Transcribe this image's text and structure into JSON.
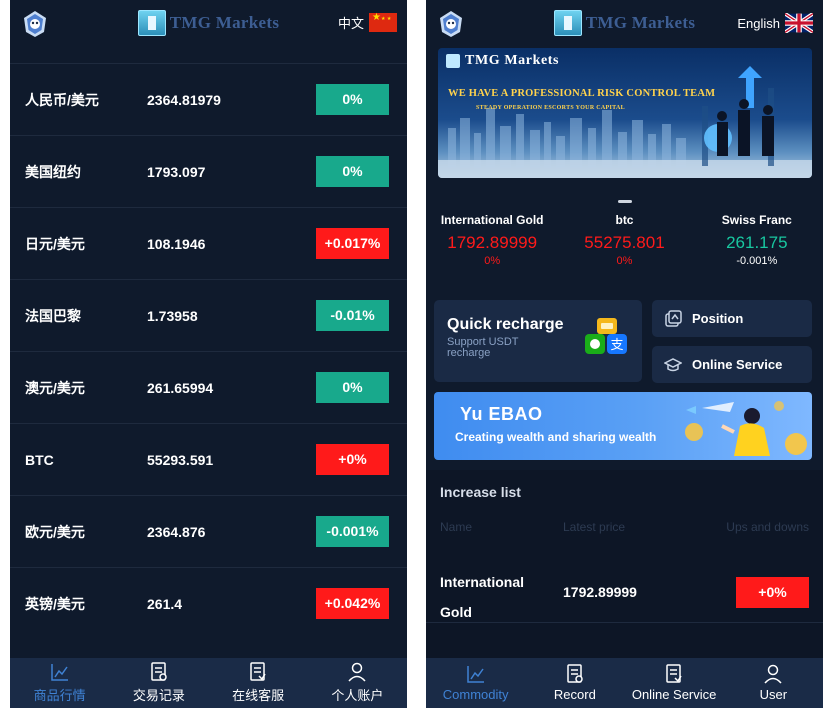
{
  "left": {
    "brand": "TMG Markets",
    "language": "中文",
    "markets": [
      {
        "name": "人民币/美元",
        "price": "2364.81979",
        "change": "0%",
        "trend": "flat"
      },
      {
        "name": "美国纽约",
        "price": "1793.097",
        "change": "0%",
        "trend": "flat"
      },
      {
        "name": "日元/美元",
        "price": "108.1946",
        "change": "+0.017%",
        "trend": "up"
      },
      {
        "name": "法国巴黎",
        "price": "1.73958",
        "change": "-0.01%",
        "trend": "down"
      },
      {
        "name": "澳元/美元",
        "price": "261.65994",
        "change": "0%",
        "trend": "flat"
      },
      {
        "name": "BTC",
        "price": "55293.591",
        "change": "+0%",
        "trend": "up"
      },
      {
        "name": "欧元/美元",
        "price": "2364.876",
        "change": "-0.001%",
        "trend": "down"
      },
      {
        "name": "英镑/美元",
        "price": "261.4",
        "change": "+0.042%",
        "trend": "up"
      }
    ],
    "tabs": [
      "商品行情",
      "交易记录",
      "在线客服",
      "个人账户"
    ]
  },
  "right": {
    "brand": "TMG Markets",
    "language": "English",
    "banner": {
      "brand": "TMG Markets",
      "headline": "WE HAVE A PROFESSIONAL RISK CONTROL TEAM",
      "subline": "STEADY OPERATION ESCORTS YOUR CAPITAL"
    },
    "tickers": [
      {
        "name": "International Gold",
        "price": "1792.89999",
        "change": "0%",
        "trend": "up"
      },
      {
        "name": "btc",
        "price": "55275.801",
        "change": "0%",
        "trend": "up"
      },
      {
        "name": "Swiss Franc",
        "price": "261.175",
        "change": "-0.001%",
        "trend": "down"
      }
    ],
    "recharge": {
      "title": "Quick recharge",
      "subtitle": "Support USDT recharge"
    },
    "position_label": "Position",
    "service_label": "Online Service",
    "promo": {
      "title": "Yu EBAO",
      "subtitle": "Creating wealth and sharing wealth"
    },
    "increase_list": {
      "title": "Increase list",
      "col_name": "Name",
      "col_price": "Latest price",
      "col_change": "Ups and downs",
      "rows": [
        {
          "name": "International Gold",
          "price": "1792.89999",
          "change": "+0%"
        }
      ]
    },
    "tabs": [
      "Commodity",
      "Record",
      "Online Service",
      "User"
    ]
  },
  "colors": {
    "background": "#0f1a2c",
    "tabbar": "#1a2b47",
    "up": "#ff1a1a",
    "down": "#18a98c",
    "accent": "#3f82d4"
  }
}
